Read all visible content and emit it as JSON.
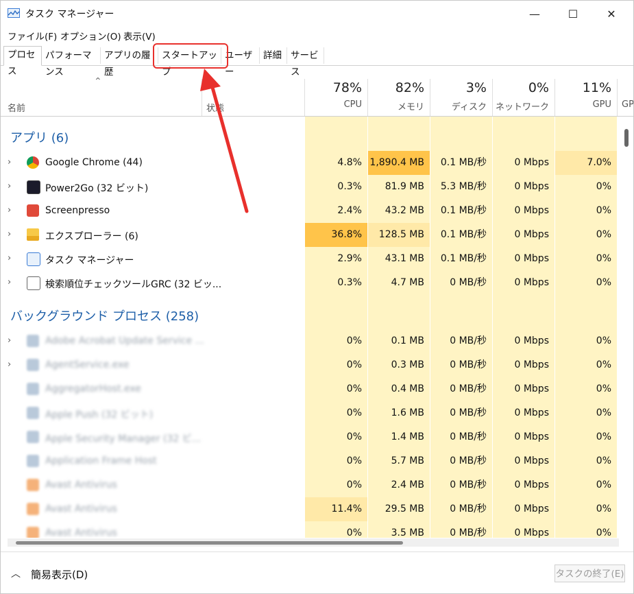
{
  "window": {
    "title": "タスク マネージャー",
    "minimize": "—",
    "maximize": "☐",
    "close": "✕"
  },
  "menu": [
    "ファイル(F)",
    "オプション(O)",
    "表示(V)"
  ],
  "tabs": [
    "プロセス",
    "パフォーマンス",
    "アプリの履歴",
    "スタートアップ",
    "ユーザー",
    "詳細",
    "サービス"
  ],
  "active_tab": "プロセス",
  "header": {
    "name": "名前",
    "status": "状態",
    "columns": [
      {
        "pct": "78%",
        "label": "CPU"
      },
      {
        "pct": "82%",
        "label": "メモリ"
      },
      {
        "pct": "3%",
        "label": "ディスク"
      },
      {
        "pct": "0%",
        "label": "ネットワーク"
      },
      {
        "pct": "11%",
        "label": "GPU"
      },
      {
        "pct": "",
        "label": "GP"
      }
    ]
  },
  "groups": {
    "apps": "アプリ (6)",
    "background": "バックグラウンド プロセス (258)"
  },
  "apps": [
    {
      "name": "Google Chrome (44)",
      "icon": "chrome-icon",
      "cells": [
        "4.8%",
        "1,890.4 MB",
        "0.1 MB/秒",
        "0 Mbps",
        "7.0%"
      ]
    },
    {
      "name": "Power2Go (32 ビット)",
      "icon": "power2go-icon",
      "cells": [
        "0.3%",
        "81.9 MB",
        "5.3 MB/秒",
        "0 Mbps",
        "0%"
      ]
    },
    {
      "name": "Screenpresso",
      "icon": "screenpresso-icon",
      "cells": [
        "2.4%",
        "43.2 MB",
        "0.1 MB/秒",
        "0 Mbps",
        "0%"
      ]
    },
    {
      "name": "エクスプローラー (6)",
      "icon": "folder-icon",
      "cells": [
        "36.8%",
        "128.5 MB",
        "0.1 MB/秒",
        "0 Mbps",
        "0%"
      ]
    },
    {
      "name": "タスク マネージャー",
      "icon": "taskmanager-icon",
      "cells": [
        "2.9%",
        "43.1 MB",
        "0.1 MB/秒",
        "0 Mbps",
        "0%"
      ]
    },
    {
      "name": "検索順位チェックツールGRC (32 ビッ...",
      "icon": "grc-icon",
      "cells": [
        "0.3%",
        "4.7 MB",
        "0 MB/秒",
        "0 Mbps",
        "0%"
      ]
    }
  ],
  "background": [
    {
      "name": "Adobe Acrobat Update Service ...",
      "cells": [
        "0%",
        "0.1 MB",
        "0 MB/秒",
        "0 Mbps",
        "0%"
      ]
    },
    {
      "name": "AgentService.exe",
      "cells": [
        "0%",
        "0.3 MB",
        "0 MB/秒",
        "0 Mbps",
        "0%"
      ]
    },
    {
      "name": "AggregatorHost.exe",
      "cells": [
        "0%",
        "0.4 MB",
        "0 MB/秒",
        "0 Mbps",
        "0%"
      ]
    },
    {
      "name": "Apple Push (32 ビット)",
      "cells": [
        "0%",
        "1.6 MB",
        "0 MB/秒",
        "0 Mbps",
        "0%"
      ]
    },
    {
      "name": "Apple Security Manager (32 ビ...",
      "cells": [
        "0%",
        "1.4 MB",
        "0 MB/秒",
        "0 Mbps",
        "0%"
      ]
    },
    {
      "name": "Application Frame Host",
      "cells": [
        "0%",
        "5.7 MB",
        "0 MB/秒",
        "0 Mbps",
        "0%"
      ]
    },
    {
      "name": "Avast Antivirus",
      "cells": [
        "0%",
        "2.4 MB",
        "0 MB/秒",
        "0 Mbps",
        "0%"
      ]
    },
    {
      "name": "Avast Antivirus",
      "cells": [
        "11.4%",
        "29.5 MB",
        "0 MB/秒",
        "0 Mbps",
        "0%"
      ]
    },
    {
      "name": "Avast Antivirus",
      "cells": [
        "0%",
        "3.5 MB",
        "0 MB/秒",
        "0 Mbps",
        "0%"
      ]
    }
  ],
  "footer": {
    "fewer_details": "簡易表示(D)",
    "end_task": "タスクの終了(E)"
  },
  "colors": {
    "accent_group": "#1e5fa8",
    "heat_low": "#fff4c4",
    "heat_mid": "#ffe9a8",
    "heat_high": "#ffd26e",
    "heat_max": "#ffc44a",
    "annotation": "#e8302c"
  }
}
